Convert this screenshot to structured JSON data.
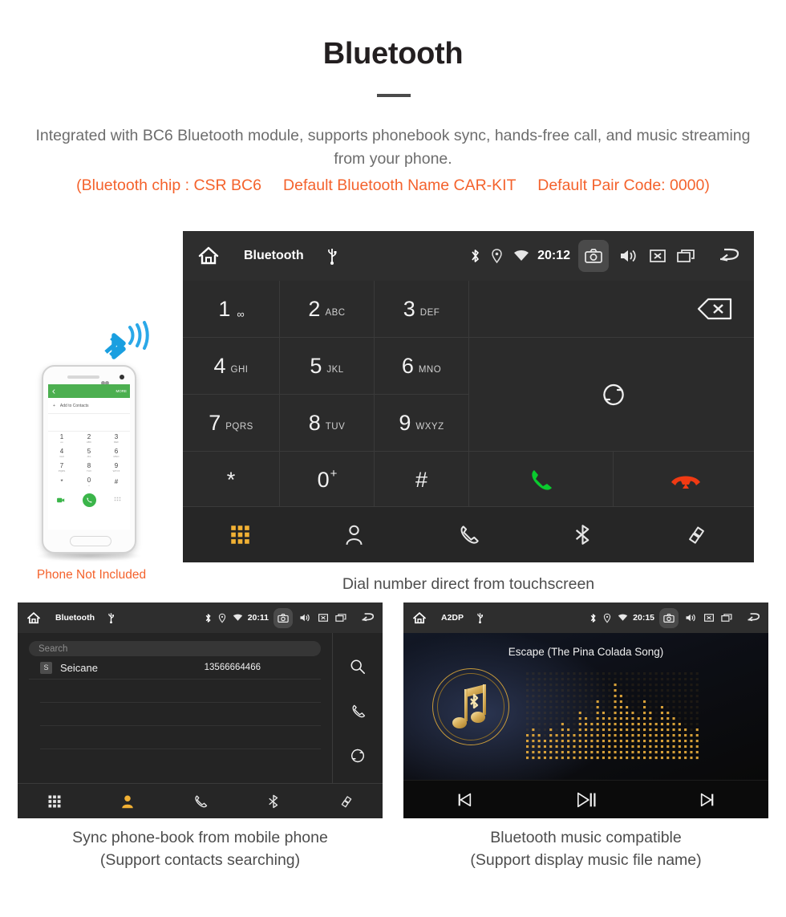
{
  "header": {
    "title": "Bluetooth",
    "subtitle": "Integrated with BC6 Bluetooth module, supports phonebook sync, hands-free call, and music streaming from your phone.",
    "spec_line": "(Bluetooth chip : CSR BC6     Default Bluetooth Name CAR-KIT     Default Pair Code: 0000)"
  },
  "phone_illustration": {
    "note": "Phone Not Included",
    "appbar_more": "MORE",
    "add_label": "Add to Contacts",
    "keys": [
      {
        "digit": "1",
        "sub": "oo"
      },
      {
        "digit": "2",
        "sub": "ABC"
      },
      {
        "digit": "3",
        "sub": "DEF"
      },
      {
        "digit": "4",
        "sub": "GHI"
      },
      {
        "digit": "5",
        "sub": "JKL"
      },
      {
        "digit": "6",
        "sub": "MNO"
      },
      {
        "digit": "7",
        "sub": "PQRS"
      },
      {
        "digit": "8",
        "sub": "TUV"
      },
      {
        "digit": "9",
        "sub": "WXYZ"
      },
      {
        "digit": "*",
        "sub": ""
      },
      {
        "digit": "0",
        "sub": "+"
      },
      {
        "digit": "#",
        "sub": ""
      }
    ]
  },
  "dialer_screen": {
    "statusbar": {
      "title": "Bluetooth",
      "time": "20:12",
      "icons": [
        "home-icon",
        "usb-icon",
        "bluetooth-icon",
        "location-icon",
        "wifi-icon",
        "camera-icon",
        "volume-icon",
        "mute-icon",
        "recents-icon",
        "back-icon"
      ]
    },
    "keypad": [
      {
        "digit": "1",
        "sub": "",
        "voicemail": true
      },
      {
        "digit": "2",
        "sub": "ABC"
      },
      {
        "digit": "3",
        "sub": "DEF"
      },
      {
        "digit": "4",
        "sub": "GHI"
      },
      {
        "digit": "5",
        "sub": "JKL"
      },
      {
        "digit": "6",
        "sub": "MNO"
      },
      {
        "digit": "7",
        "sub": "PQRS"
      },
      {
        "digit": "8",
        "sub": "TUV"
      },
      {
        "digit": "9",
        "sub": "WXYZ"
      },
      {
        "digit": "*",
        "sub": ""
      },
      {
        "digit": "0",
        "sub": "+"
      },
      {
        "digit": "#",
        "sub": ""
      }
    ],
    "actions": {
      "backspace": "backspace-icon",
      "sync": "sync-icon",
      "call": "call-icon",
      "hangup": "hangup-icon",
      "call_color": "#0ACB2E",
      "hangup_color": "#F03A13"
    },
    "tabs": [
      {
        "name": "keypad",
        "icon": "keypad-icon",
        "active": true
      },
      {
        "name": "contacts",
        "icon": "contact-icon",
        "active": false
      },
      {
        "name": "call-log",
        "icon": "phone-icon",
        "active": false
      },
      {
        "name": "bluetooth",
        "icon": "bluetooth-icon",
        "active": false
      },
      {
        "name": "link",
        "icon": "link-icon",
        "active": false
      }
    ],
    "active_color": "#F2B134",
    "caption": "Dial number direct from touchscreen"
  },
  "phonebook_screen": {
    "statusbar": {
      "title": "Bluetooth",
      "time": "20:11"
    },
    "search_placeholder": "Search",
    "contacts": [
      {
        "initial": "S",
        "name": "Seicane",
        "number": "13566664466"
      }
    ],
    "side_actions": [
      "search-icon",
      "phone-icon",
      "sync-icon"
    ],
    "tabs": [
      {
        "name": "keypad",
        "icon": "keypad-icon",
        "active": false
      },
      {
        "name": "contacts",
        "icon": "contact-icon",
        "active": true
      },
      {
        "name": "call-log",
        "icon": "phone-icon",
        "active": false
      },
      {
        "name": "bluetooth",
        "icon": "bluetooth-icon",
        "active": false
      },
      {
        "name": "link",
        "icon": "link-icon",
        "active": false
      }
    ],
    "caption_line1": "Sync phone-book from mobile phone",
    "caption_line2": "(Support contacts searching)"
  },
  "music_screen": {
    "statusbar": {
      "title": "A2DP",
      "time": "20:15"
    },
    "song_title": "Escape (The Pina Colada Song)",
    "controls": [
      {
        "name": "previous",
        "icon": "skip-previous-icon"
      },
      {
        "name": "play-pause",
        "icon": "play-pause-icon"
      },
      {
        "name": "next",
        "icon": "skip-next-icon"
      }
    ],
    "accent_color": "#C79A3A",
    "caption_line1": "Bluetooth music compatible",
    "caption_line2": "(Support display music file name)"
  }
}
